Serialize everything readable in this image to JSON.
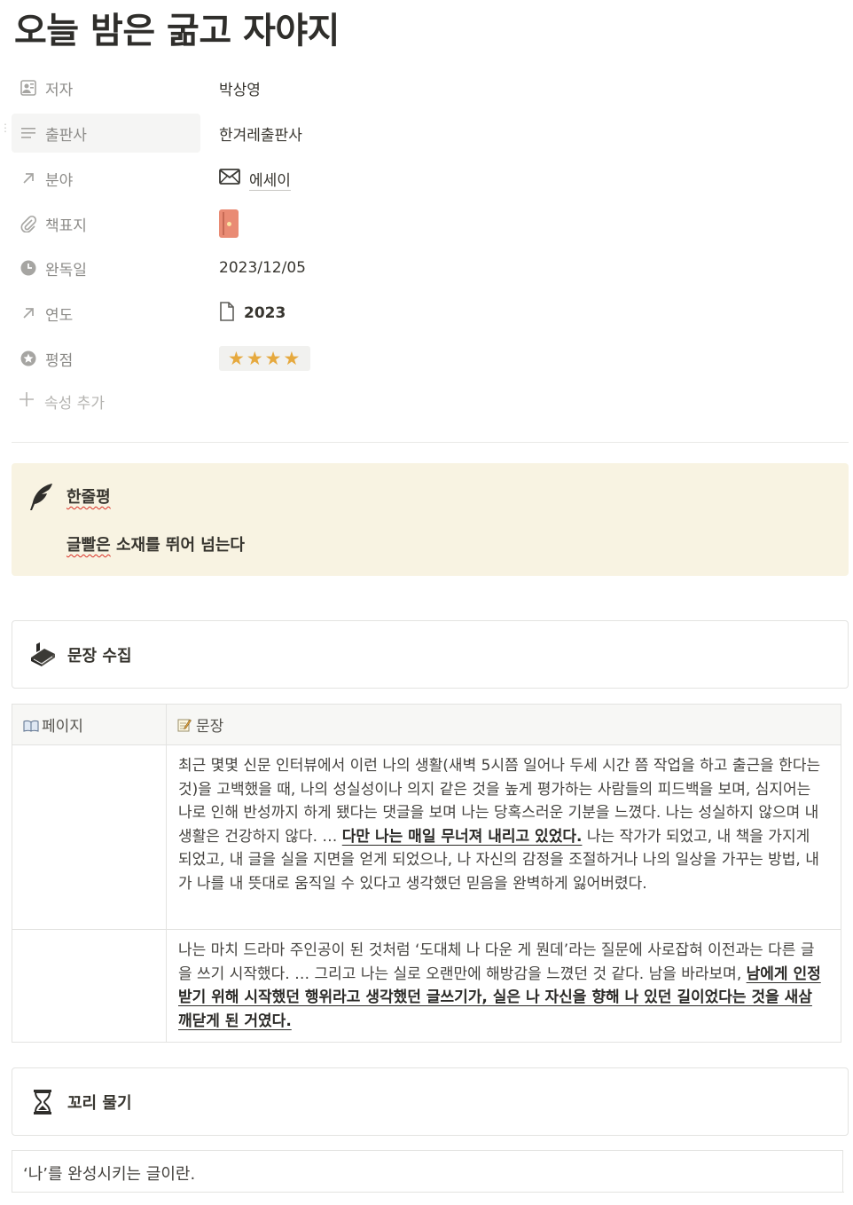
{
  "page": {
    "title": "오늘 밤은 굶고 자야지"
  },
  "properties": [
    {
      "label": "저자",
      "icon": "person-icon",
      "value": "박상영"
    },
    {
      "label": "출판사",
      "icon": "text-lines-icon",
      "value": "한겨레출판사"
    },
    {
      "label": "분야",
      "icon": "arrow-up-right-icon",
      "value": "에세이",
      "value_icon": "envelope-icon"
    },
    {
      "label": "책표지",
      "icon": "paperclip-icon",
      "value_icon": "book-cover-icon"
    },
    {
      "label": "완독일",
      "icon": "clock-icon",
      "value": "2023/12/05"
    },
    {
      "label": "연도",
      "icon": "arrow-up-right-icon",
      "value": "2023",
      "value_icon": "document-icon"
    },
    {
      "label": "평점",
      "icon": "star-circle-icon",
      "value": "★★★★",
      "rating": 4
    }
  ],
  "add_property": "속성 추가",
  "callout": {
    "title": "한줄평",
    "body_prefix": "글빨은",
    "body_rest": " 소재를 뛰어 넘는다",
    "icon": "feather-icon",
    "background": "#f8f3e2"
  },
  "collect_section": {
    "title": "문장 수집",
    "icon": "book-stack-icon"
  },
  "quotes_table": {
    "headers": [
      "페이지",
      "문장"
    ],
    "rows": [
      {
        "page": "",
        "text_a": "최근 몇몇 신문 인터뷰에서 이런 나의 생활(새벽 5시쯤 일어나 두세 시간 쯤 작업을 하고 출근을 한다는 것)을 고백했을 때, 나의 성실성이나 의지 같은 것을 높게 평가하는 사람들의 피드백을 보며, 심지어는 나로 인해 반성까지 하게 됐다는 댓글을 보며 나는 당혹스러운 기분을 느꼈다. 나는 성실하지 않으며 내 생활은 건강하지 않다. … ",
        "highlight": "다만 나는 매일 무너져 내리고 있었다.",
        "text_b": " 나는 작가가 되었고, 내 책을 가지게 되었고, 내 글을 실을 지면을 얻게 되었으나, 나 자신의 감정을 조절하거나 나의 일상을 가꾸는 방법, 내가 나를 내 뜻대로 움직일 수 있다고 생각했던 믿음을 완벽하게 잃어버렸다."
      },
      {
        "page": "",
        "text_a": "나는 마치 드라마 주인공이 된 것처럼 ‘도대체 나 다운 게 뭔데’라는 질문에 사로잡혀 이전과는 다른 글을 쓰기 시작했다. … 그리고 나는 실로 오랜만에 해방감을 느꼈던 것 같다. 남을 바라보며, ",
        "highlight": "남에게 인정받기 위해 시작했던 행위라고 생각했던 글쓰기가, 실은 나 자신을 향해 나 있던 길이었다는 것을 새삼 깨닫게 된 거였다.",
        "text_b": ""
      }
    ]
  },
  "tail_section": {
    "title": "꼬리 물기",
    "icon": "hourglass-icon"
  },
  "tail_text": "‘나’를 완성시키는 글이란."
}
